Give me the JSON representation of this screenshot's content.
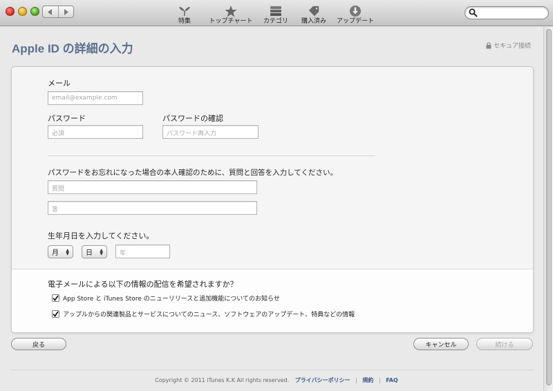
{
  "toolbar": {
    "items": [
      {
        "label": "特集",
        "icon": "featured-icon"
      },
      {
        "label": "トップチャート",
        "icon": "star-icon"
      },
      {
        "label": "カテゴリ",
        "icon": "categories-icon"
      },
      {
        "label": "購入済み",
        "icon": "tag-icon"
      },
      {
        "label": "アップデート",
        "icon": "download-icon"
      }
    ],
    "search_placeholder": ""
  },
  "page": {
    "title": "Apple ID の詳細の入力",
    "secure_label": "セキュア接続"
  },
  "form": {
    "email_label": "メール",
    "email_placeholder": "email@example.com",
    "password_label": "パスワード",
    "password_placeholder": "必須",
    "confirm_label": "パスワードの確認",
    "confirm_placeholder": "パスワード再入力",
    "security_prompt": "パスワードをお忘れになった場合の本人確認のために、質問と回答を入力してください。",
    "question_placeholder": "質問",
    "answer_placeholder": "答",
    "birthday_prompt": "生年月日を入力してください。",
    "month_value": "月",
    "day_value": "日",
    "year_placeholder": "年"
  },
  "newsletter": {
    "prompt": "電子メールによる以下の情報の配信を希望されますか？",
    "options": [
      {
        "label": "App Store と iTunes Store のニューリリースと追加機能についてのお知らせ",
        "checked": true
      },
      {
        "label": "アップルからの関連製品とサービスについてのニュース、ソフトウェアのアップデート、特典などの情報",
        "checked": true
      }
    ]
  },
  "buttons": {
    "back": "戻る",
    "cancel": "キャンセル",
    "continue": "続ける"
  },
  "footer": {
    "copyright": "Copyright © 2011 iTunes K.K All rights reserved.",
    "privacy": "プライバシーポリシー",
    "sep": "|",
    "terms": "規約",
    "faq": "FAQ"
  },
  "colors": {
    "title": "#5d6f8e",
    "link": "#3b5a8a"
  }
}
